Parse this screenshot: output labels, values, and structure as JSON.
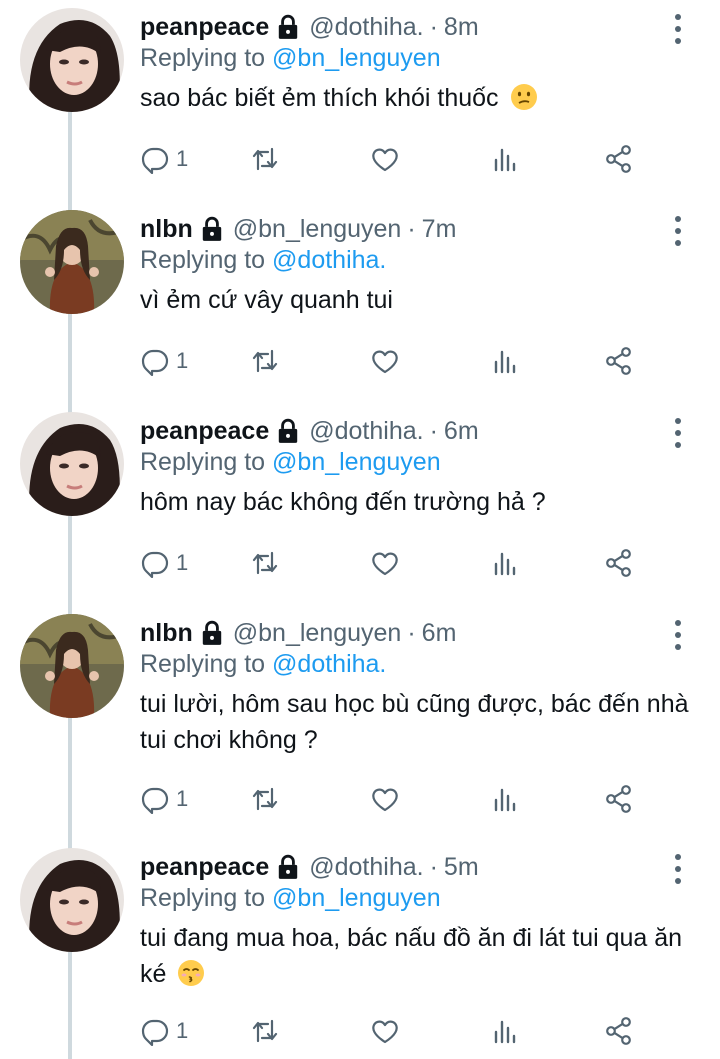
{
  "tweets": [
    {
      "name": "peanpeace",
      "handle": "@dothiha.",
      "sep": "·",
      "time": "8m",
      "replying_prefix": "Replying to",
      "replying_to": "@bn_lenguyen",
      "text": "sao bác biết ẻm thích khói thuốc",
      "emoji": "confused-face",
      "reply_count": "1"
    },
    {
      "name": "nlbn",
      "handle": "@bn_lenguyen",
      "sep": "·",
      "time": "7m",
      "replying_prefix": "Replying to",
      "replying_to": "@dothiha.",
      "text": "vì ẻm cứ vây quanh tui",
      "reply_count": "1"
    },
    {
      "name": "peanpeace",
      "handle": "@dothiha.",
      "sep": "·",
      "time": "6m",
      "replying_prefix": "Replying to",
      "replying_to": "@bn_lenguyen",
      "text": "hôm nay bác không đến trường hả ?",
      "reply_count": "1"
    },
    {
      "name": "nlbn",
      "handle": "@bn_lenguyen",
      "sep": "·",
      "time": "6m",
      "replying_prefix": "Replying to",
      "replying_to": "@dothiha.",
      "text": "tui lười, hôm sau học bù cũng được, bác đến nhà tui chơi không ?",
      "reply_count": "1"
    },
    {
      "name": "peanpeace",
      "handle": "@dothiha.",
      "sep": "·",
      "time": "5m",
      "replying_prefix": "Replying to",
      "replying_to": "@bn_lenguyen",
      "text": "tui đang mua hoa, bác nấu đồ ăn đi lát tui qua ăn ké",
      "emoji": "kissing-face",
      "reply_count": "1"
    }
  ],
  "colors": {
    "text": "#0f1419",
    "secondary": "#536471",
    "link": "#1d9bf0",
    "thread_line": "#cfd9de",
    "background": "#ffffff"
  },
  "icons": [
    "lock-icon",
    "more-vertical-icon",
    "reply-icon",
    "retweet-icon",
    "like-icon",
    "analytics-icon",
    "share-icon"
  ]
}
